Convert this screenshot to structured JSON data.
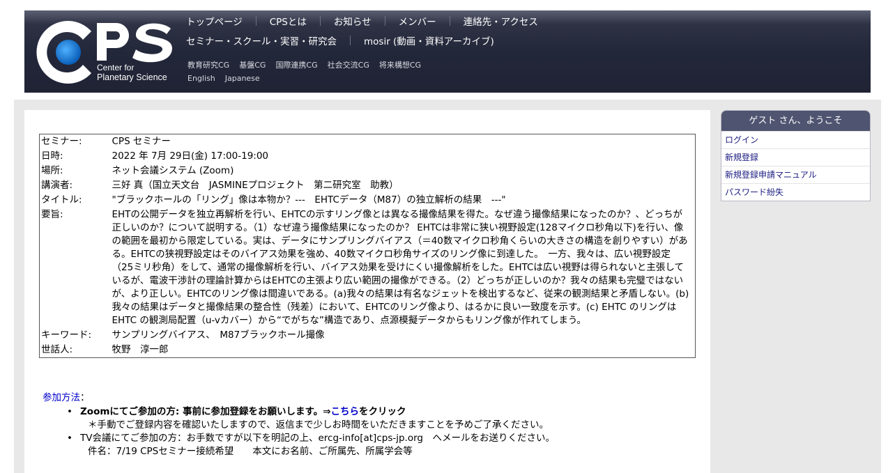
{
  "header": {
    "logo": {
      "letters": "CPS",
      "line1": "Center for",
      "line2": "Planetary Science",
      "accent": "#1177cc"
    },
    "nav_main": [
      "トップページ",
      "CPSとは",
      "お知らせ",
      "メンバー",
      "連絡先・アクセス"
    ],
    "nav_second": [
      "セミナー・スクール・実習・研究会",
      "mosir (動画・資料アーカイブ)"
    ],
    "nav_cg": [
      "教育研究CG",
      "基盤CG",
      "国際連携CG",
      "社会交流CG",
      "将来構想CG"
    ],
    "nav_lang": [
      "English",
      "Japanese"
    ]
  },
  "seminar": {
    "rows": [
      {
        "key": "セミナー:",
        "value": "CPS セミナー"
      },
      {
        "key": "日時:",
        "value": "2022 年 7月 29日(金) 17:00-19:00"
      },
      {
        "key": "場所:",
        "value": "ネット会議システム (Zoom)"
      },
      {
        "key": "講演者:",
        "value": "三好 真（国立天文台　JASMINEプロジェクト　第二研究室　助教）"
      },
      {
        "key": "タイトル:",
        "value": "\"ブラックホールの「リング」像は本物か？---　EHTCデータ（M87）の独立解析の結果　---\""
      },
      {
        "key": "要旨:",
        "value": "EHTの公開データを独立再解析を行い、EHTCの示すリング像とは異なる撮像結果を得た。なぜ違う撮像結果になったのか？、どっちが正しいのか？について説明する。（1）なぜ違う撮像結果になったのか？ EHTCは非常に狭い視野設定(128マイクロ秒角以下)を行い、像の範囲を最初から限定している。実は、データにサンプリングバイアス（＝40数マイクロ秒角くらいの大きさの構造を創りやすい）がある。EHTCの狭視野設定はそのバイアス効果を強め、40数マイクロ秒角サイズのリング像に到達した。　一方、我々は、広い視野設定（25ミリ秒角）をして、通常の撮像解析を行い、バイアス効果を受けにくい撮像解析をした。EHTCは広い視野は得られないと主張しているが、電波干渉計の理論計算からはEHTCの主張より広い範囲の撮像ができる。（2）どっちが正しいのか？我々の結果も完璧ではないが、より正しい。EHTCのリング像は間違いである。(a)我々の結果は有名なジェットを検出するなど、従来の観測結果と矛盾しない。(b)我々の結果はデータと撮像結果の整合性（残差）において、EHTCのリング像より、はるかに良い一致度を示す。(c) EHTC のリングはEHTC の観測局配置（u-vカバー）から“でがちな”構造であり、点源模擬データからもリング像が作れてしまう。"
      },
      {
        "key": "キーワード:",
        "value": "サンプリングバイアス、　M87ブラックホール撮像"
      },
      {
        "key": "世話人:",
        "value": "牧野　淳一郎"
      }
    ]
  },
  "join": {
    "title": "参加方法",
    "colon": "：",
    "zoom_prefix": "Zoomにてご参加の方: 事前に参加登録をお願いします。⇒",
    "zoom_link": "こちら",
    "zoom_suffix": "をクリック",
    "zoom_note": "＊手動でご登録内容を確認いたしますので、返信まで少しお時間をいただきますことを予めご了承ください。",
    "tv_line": "TV会議にてご参加の方：お手数ですが以下を明記の上、ercg-info[at]cps-jp.org　へメールをお送りください。",
    "tv_note": "件名：7/19 CPSセミナー接続希望　　本文にお名前、ご所属先、所属学会等"
  },
  "sidebar": {
    "greeting": "ゲスト さん、ようこそ",
    "items": [
      "ログイン",
      "新規登録",
      "新規登録申請マニュアル",
      "パスワード紛失"
    ]
  }
}
